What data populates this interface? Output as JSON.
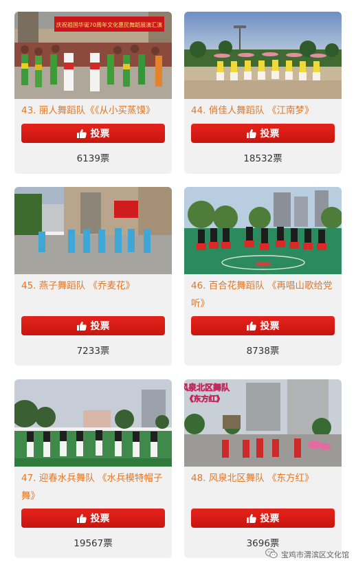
{
  "cards": [
    {
      "caption": "43. 丽人舞蹈队《《从小买蒸馍》",
      "vote_label": "投票",
      "votes": "6139票",
      "banner_text": "庆祝祖国华诞70周年文化惠民舞蹈展演汇演"
    },
    {
      "caption": "44. 俏佳人舞蹈队 《江南梦》",
      "vote_label": "投票",
      "votes": "18532票"
    },
    {
      "caption": "45. 燕子舞蹈队 《乔麦花》",
      "vote_label": "投票",
      "votes": "7233票"
    },
    {
      "caption": "46. 百合花舞蹈队 《再唱山歌给党听》",
      "vote_label": "投票",
      "votes": "8738票"
    },
    {
      "caption": "47. 迎春水兵舞队 《水兵模特帽子舞》",
      "vote_label": "投票",
      "votes": "19567票"
    },
    {
      "caption": "48. 风泉北区舞队 《东方红》",
      "vote_label": "投票",
      "votes": "3696票",
      "overlay_line1": "风泉北区舞队",
      "overlay_line2": "《东方红》"
    }
  ],
  "watermark": {
    "text": "宝鸡市渭滨区文化馆",
    "icon": "wechat-icon"
  },
  "colors": {
    "accent": "#d8161c",
    "caption": "#e0782a",
    "card_bg": "#f1f1f1"
  }
}
